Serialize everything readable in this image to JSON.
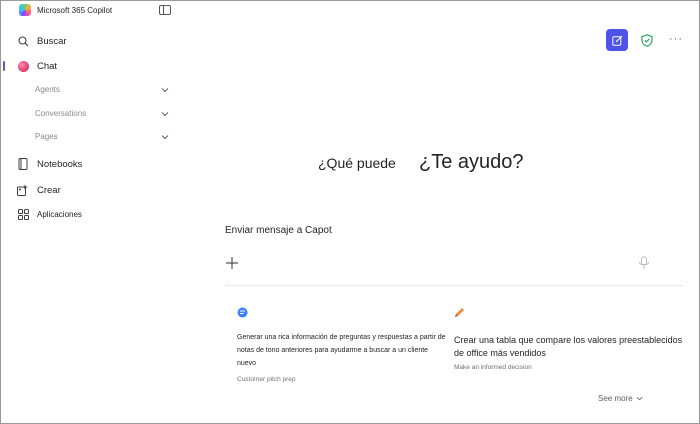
{
  "app": {
    "title": "Microsoft 365 Copilot"
  },
  "sidebar": {
    "search_label": "Buscar",
    "chat_label": "Chat",
    "sub_items": [
      {
        "label": "Agents"
      },
      {
        "label": "Conversations"
      },
      {
        "label": "Pages"
      }
    ],
    "notebooks_label": "Notebooks",
    "create_label": "Crear",
    "apps_label": "Aplicaciones"
  },
  "header": {
    "more_label": "···"
  },
  "greeting": {
    "small": "¿Qué puede",
    "large": "¿Te ayudo?"
  },
  "composer": {
    "title": "Enviar mensaje a Capot"
  },
  "cards": [
    {
      "text": "Generar una rica información de preguntas y respuestas a partir de notas de tono anteriores para ayudarme a buscar a un cliente nuevo",
      "tag": "Customer pitch prep"
    },
    {
      "text": "Crear una tabla que compare los valores preestablecidos de office más vendidos",
      "tag": "Make an informed decision"
    }
  ],
  "see_more": {
    "label": "See more"
  },
  "colors": {
    "accent": "#4f52e8",
    "shield": "#1f9d55",
    "active_indicator": "#5b5fc7"
  }
}
